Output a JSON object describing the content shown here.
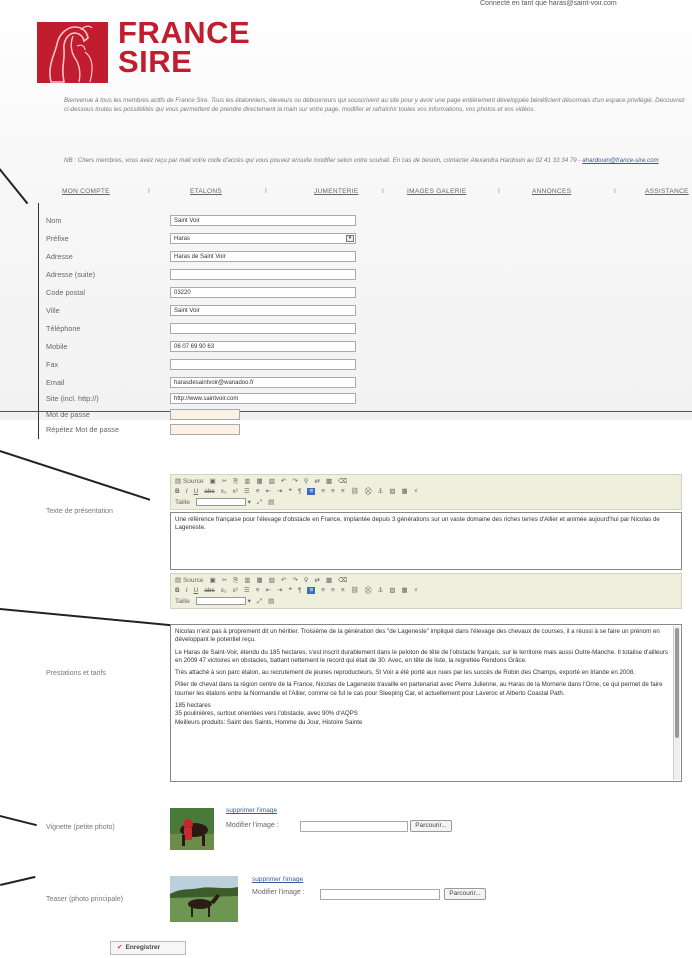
{
  "header": {
    "top_text": "Connecté en tant que haras@saint-voir.com",
    "logo": {
      "line1": "FRANCE",
      "line2": "SIRE"
    }
  },
  "intro_text": "Bienvenue à tous les membres actifs de France Sire. Tous les étalonniers, éleveurs ou débourreurs qui souscrivent au site pour y avoir une page entièrement développée bénéficient désormais d'un espace privilégié. Découvrez ci-dessous toutes les possibilités qui vous permettent de prendre directement la main sur votre page, modifier et rafraîchir toutes vos informations, vos photos et vos vidéos.",
  "nb": {
    "text": "NB : Chers membres, vous avez reçu par mail votre code d'accès qui vous pouvez ensuite modifier selon votre souhait. En cas de besoin, contacter Alexandra Hardouin au 02 41 33 34 79 - ",
    "email": "ahardouin@france-sire.com"
  },
  "nav": {
    "items": [
      "MON COMPTE",
      "ETALONS",
      "JUMENTERIE",
      "IMAGES GALERIE",
      "ANNONCES",
      "ASSISTANCE"
    ],
    "separator": "I"
  },
  "form": {
    "fields": [
      {
        "label": "Nom",
        "value": "Saint Voir"
      },
      {
        "label": "Préfixe",
        "value": "Haras",
        "type": "select"
      },
      {
        "label": "Adresse",
        "value": "Haras de Saint Voir"
      },
      {
        "label": "Adresse (suite)",
        "value": ""
      },
      {
        "label": "Code postal",
        "value": "03220"
      },
      {
        "label": "Ville",
        "value": "Saint Voir"
      },
      {
        "label": "Téléphone",
        "value": ""
      },
      {
        "label": "Mobile",
        "value": "06 07 69 90 63"
      },
      {
        "label": "Fax",
        "value": ""
      },
      {
        "label": "Email",
        "value": "harasdesaintvoir@wanadoo.fr"
      },
      {
        "label": "Site (incl. http://)",
        "value": "http://www.saintvoir.com"
      },
      {
        "label": "Mot de passe",
        "value": "",
        "type": "password"
      },
      {
        "label": "Répétez Mot de passe",
        "value": "",
        "type": "password"
      }
    ]
  },
  "toolbar": {
    "source": "Source",
    "style_label": "Taille"
  },
  "presentation": {
    "label": "Texte de présentation",
    "text": "Une référence française pour l'élevage d'obstacle en France, implantée depuis 3 générations sur un vaste domaine des riches terres d'Allier et animée aujourd'hui par Nicolas de Lageneste."
  },
  "prestations": {
    "label": "Prestations et tarifs",
    "paragraphs": [
      "Nicolas n'est pas à proprement dit un héritier. Troisième de la génération des \"de Lageneste\" impliqué dans l'élevage des chevaux de courses, il a réussi à se faire un prénom en développant le potentiel reçu.",
      "Le Haras de Saint-Voir, étendu du 185 hectares, s'est inscrit durablement dans le peloton de tête de l'obstacle français, sur le territoire mais aussi Outre-Manche. Il totalise d'ailleurs en 2009 47 victoires en obstacles, battant nettement le record qui était de 30. Avec, en tête de liste, la regrettée Rendons Grâce.",
      "Très attaché à son parc étalon, au recrutement de jeunes reproducteurs, St Voir a été porté aux nues par les succès de Robin des Champs, exporté en Irlande en 2008.",
      "Pilier de cheval dans la région centre de la France, Nicolas de Lageneste travaille en partenariat avec Pierre Julienne, au Haras de la Mornerie dans l'Orne, ce qui permet de faire tourner les étalons entre la Normandie et l'Allier, comme ce fut le cas pour Sleeping Car, et actuellement pour Laveroc et Alberto Coastal Path.",
      "185 hectares",
      "35 poulinières, surtout orientées vers l'obstacle, avec 90% d'AQPS",
      "Meilleurs produits: Saint des Saints, Homme du Jour, Histoire Sainte"
    ]
  },
  "vignette": {
    "label": "Vignette (petite photo)",
    "delete": "supprimer l'image",
    "modify": "Modifier l'image :",
    "browse": "Parcourir..."
  },
  "teaser": {
    "label": "Teaser (photo principale)",
    "delete": "supprimer l'image",
    "modify": "Modifier l'image :",
    "browse": "Parcourir..."
  },
  "save_label": "Enregistrer",
  "colors": {
    "brand": "#c21d2e",
    "link": "#3a5a9c",
    "toolbar_bg": "#efefde"
  }
}
